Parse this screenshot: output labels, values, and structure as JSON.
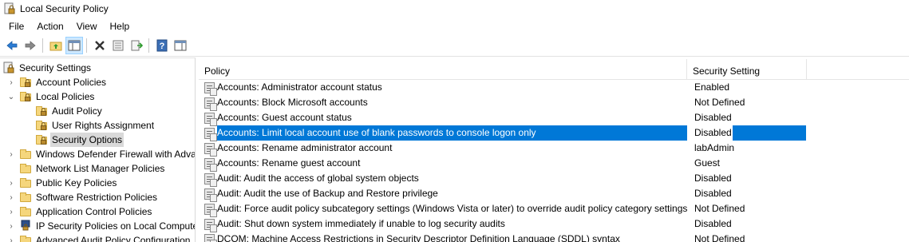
{
  "window": {
    "title": "Local Security Policy"
  },
  "menu": [
    "File",
    "Action",
    "View",
    "Help"
  ],
  "toolbar": {
    "buttons": [
      "back-icon",
      "forward-icon",
      "up-folder-icon",
      "show-hide-tree-icon",
      "delete-icon",
      "properties-icon",
      "export-list-icon",
      "help-icon",
      "action-pane-icon"
    ]
  },
  "tree": {
    "items": [
      {
        "label": "Security Settings",
        "icon": "security-settings-icon",
        "chevron": ""
      },
      {
        "label": "Account Policies",
        "icon": "folder-lock-icon",
        "chevron": "right"
      },
      {
        "label": "Local Policies",
        "icon": "folder-lock-icon",
        "chevron": "down"
      },
      {
        "label": "Audit Policy",
        "icon": "folder-lock-icon",
        "chevron": ""
      },
      {
        "label": "User Rights Assignment",
        "icon": "folder-lock-icon",
        "chevron": ""
      },
      {
        "label": "Security Options",
        "icon": "folder-lock-icon",
        "chevron": "",
        "selected": true
      },
      {
        "label": "Windows Defender Firewall with Adva",
        "icon": "folder-icon",
        "chevron": "right"
      },
      {
        "label": "Network List Manager Policies",
        "icon": "folder-icon",
        "chevron": ""
      },
      {
        "label": "Public Key Policies",
        "icon": "folder-icon",
        "chevron": "right"
      },
      {
        "label": "Software Restriction Policies",
        "icon": "folder-icon",
        "chevron": "right"
      },
      {
        "label": "Application Control Policies",
        "icon": "folder-icon",
        "chevron": "right"
      },
      {
        "label": "IP Security Policies on Local Compute",
        "icon": "ip-security-icon",
        "chevron": "right"
      },
      {
        "label": "Advanced Audit Policy Configuration",
        "icon": "folder-icon",
        "chevron": "right"
      }
    ]
  },
  "list": {
    "columns": {
      "policy": "Policy",
      "setting": "Security Setting"
    },
    "rows": [
      {
        "policy": "Accounts: Administrator account status",
        "setting": "Enabled"
      },
      {
        "policy": "Accounts: Block Microsoft accounts",
        "setting": "Not Defined"
      },
      {
        "policy": "Accounts: Guest account status",
        "setting": "Disabled"
      },
      {
        "policy": "Accounts: Limit local account use of blank passwords to console logon only",
        "setting": "Disabled",
        "selected": true
      },
      {
        "policy": "Accounts: Rename administrator account",
        "setting": "labAdmin"
      },
      {
        "policy": "Accounts: Rename guest account",
        "setting": "Guest"
      },
      {
        "policy": "Audit: Audit the access of global system objects",
        "setting": "Disabled"
      },
      {
        "policy": "Audit: Audit the use of Backup and Restore privilege",
        "setting": "Disabled"
      },
      {
        "policy": "Audit: Force audit policy subcategory settings (Windows Vista or later) to override audit policy category settings",
        "setting": "Not Defined"
      },
      {
        "policy": "Audit: Shut down system immediately if unable to log security audits",
        "setting": "Disabled"
      },
      {
        "policy": "DCOM: Machine Access Restrictions in Security Descriptor Definition Language (SDDL) syntax",
        "setting": "Not Defined"
      }
    ]
  },
  "colors": {
    "selection": "#0078d7",
    "tree_selection": "#d9d9d9",
    "folder": "#f5d67c"
  }
}
